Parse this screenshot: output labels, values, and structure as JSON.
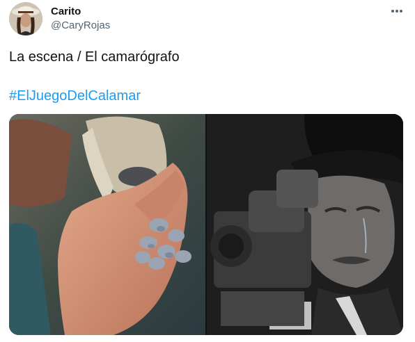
{
  "author": {
    "name": "Carito",
    "handle": "@CaryRojas"
  },
  "tweet": {
    "text": "La escena / El camarógrafo",
    "hashtag": "#ElJuegoDelCalamar"
  },
  "media": {
    "left_image": "hand-with-marbles",
    "right_image": "cameraman-crying"
  },
  "colors": {
    "link": "#1d9bf0",
    "secondary_text": "#536471",
    "primary_text": "#0f1419"
  }
}
